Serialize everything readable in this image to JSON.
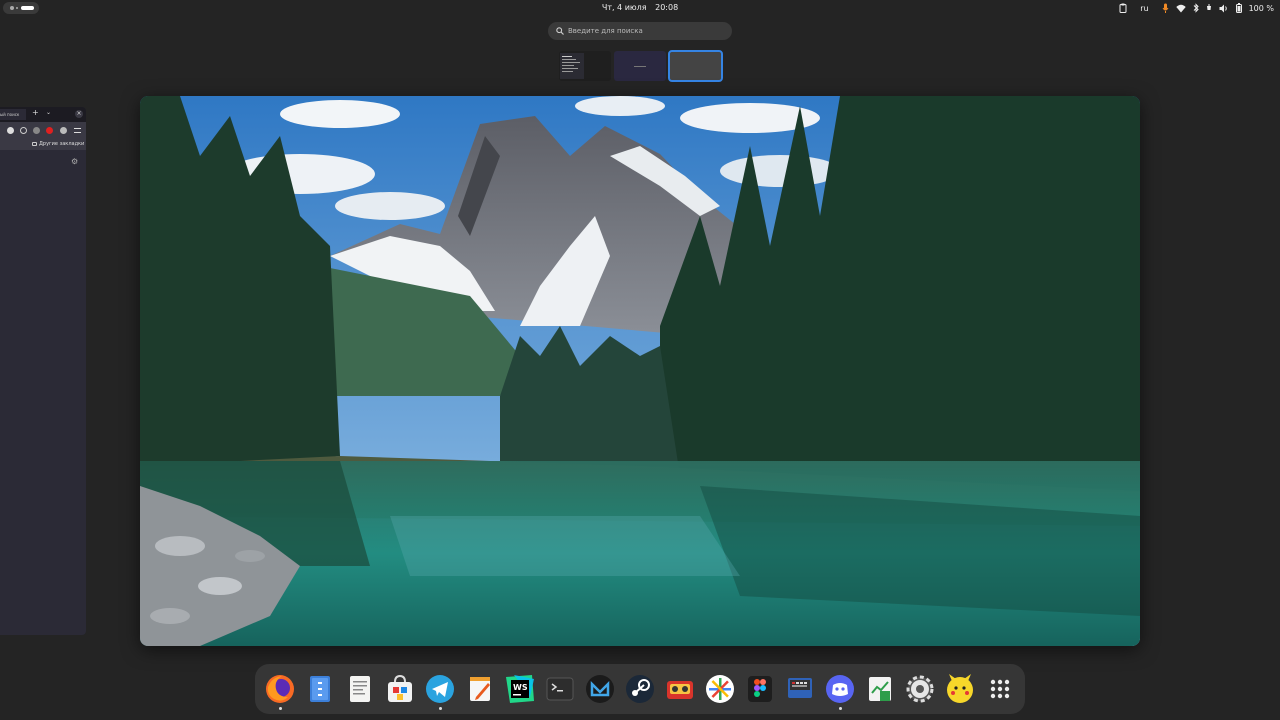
{
  "topbar": {
    "clock_day": "Чт, 4 июля",
    "clock_time": "20:08",
    "keyboard_layout": "ru",
    "battery_percent": "100 %"
  },
  "search": {
    "placeholder": "Введите для поиска"
  },
  "browser_window": {
    "tab_label": "ый поиск",
    "bookmarks_folder_label": "Другие закладки"
  },
  "dock": {
    "apps": [
      {
        "name": "firefox-icon",
        "running": true
      },
      {
        "name": "files-icon",
        "running": false
      },
      {
        "name": "text-editor-icon",
        "running": false
      },
      {
        "name": "software-store-icon",
        "running": false
      },
      {
        "name": "telegram-icon",
        "running": true
      },
      {
        "name": "notes-icon",
        "running": false
      },
      {
        "name": "webstorm-icon",
        "running": false
      },
      {
        "name": "terminal-icon",
        "running": false
      },
      {
        "name": "mailspring-icon",
        "running": false
      },
      {
        "name": "steam-icon",
        "running": false
      },
      {
        "name": "video-recorder-icon",
        "running": false
      },
      {
        "name": "color-wheel-icon",
        "running": false
      },
      {
        "name": "figma-icon",
        "running": false
      },
      {
        "name": "keyboard-app-icon",
        "running": false
      },
      {
        "name": "discord-icon",
        "running": true
      },
      {
        "name": "spreadsheet-icon",
        "running": false
      },
      {
        "name": "settings-gear-icon",
        "running": false
      },
      {
        "name": "pikachu-icon",
        "running": false
      },
      {
        "name": "app-grid-icon",
        "running": false
      }
    ]
  },
  "colors": {
    "accent": "#3584e4",
    "background": "#242424",
    "dock": "#363636"
  }
}
